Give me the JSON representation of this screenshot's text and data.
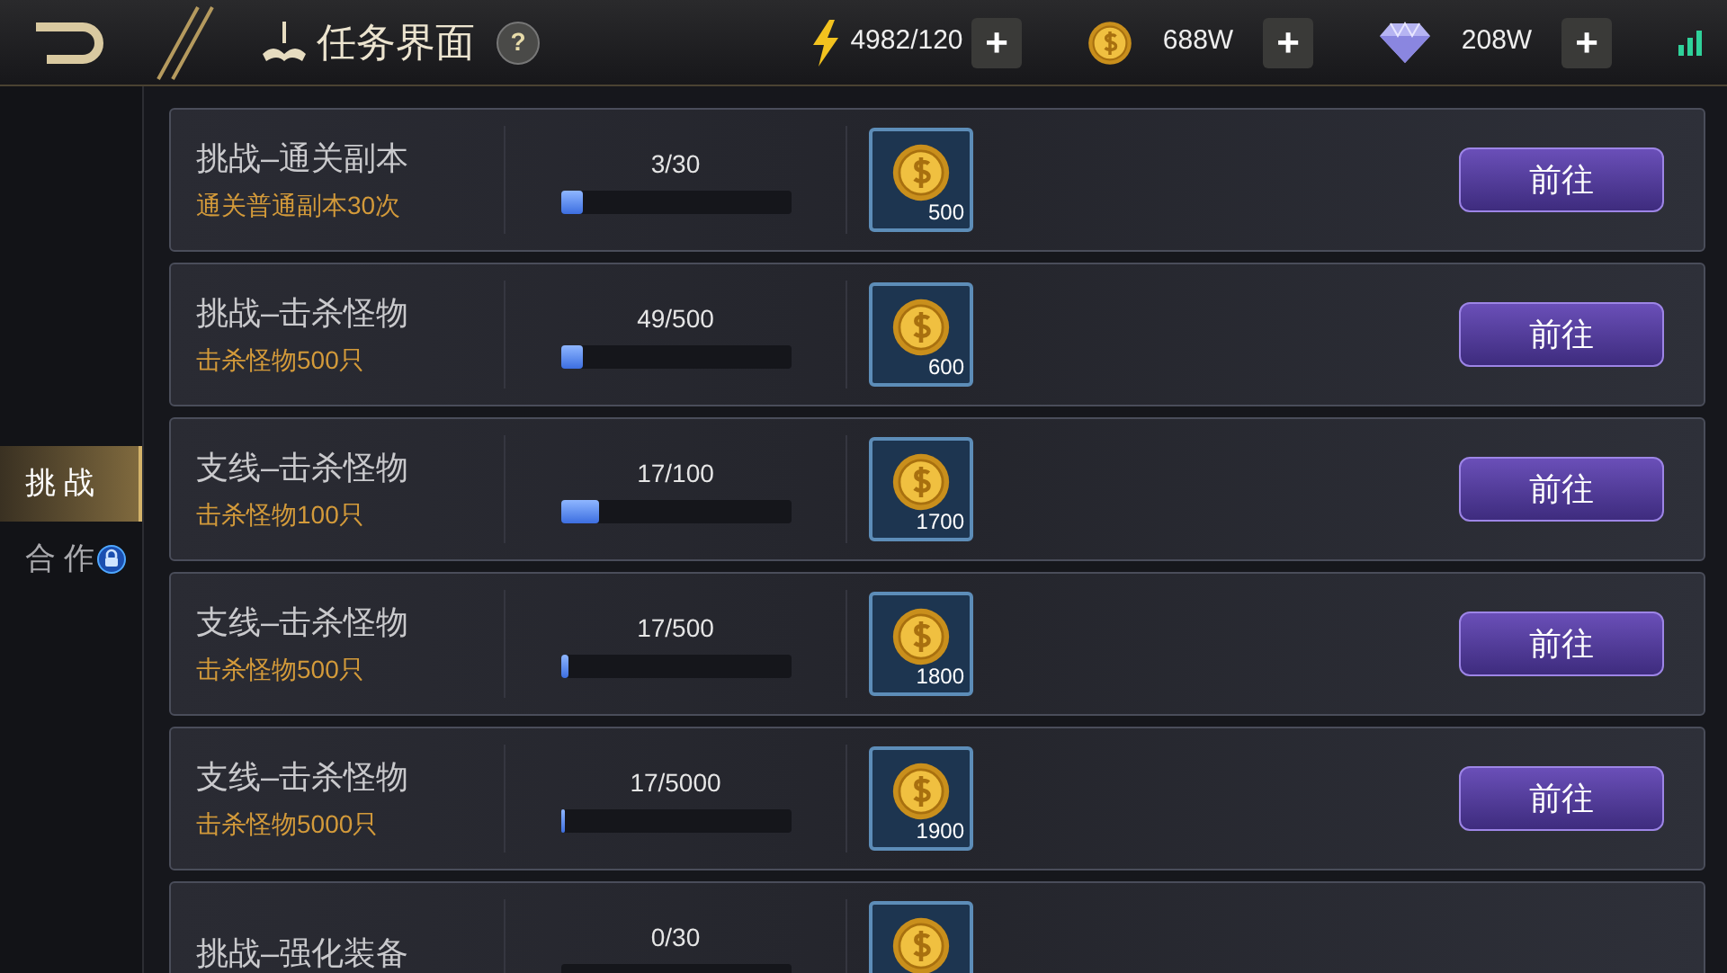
{
  "header": {
    "title": "任务界面",
    "help": "?"
  },
  "resources": [
    {
      "kind": "energy",
      "value": "4982/120",
      "add": "+"
    },
    {
      "kind": "coin",
      "value": "688W",
      "add": "+"
    },
    {
      "kind": "diamond",
      "value": "208W",
      "add": "+"
    }
  ],
  "sidebar": {
    "tabs": [
      {
        "label": "挑 战",
        "selected": true,
        "locked": false
      },
      {
        "label": "合 作",
        "selected": false,
        "locked": true
      }
    ]
  },
  "tasks": [
    {
      "title": "挑战–通关副本",
      "description": "通关普通副本30次",
      "progress": "3/30",
      "level": 0.1,
      "reward": "500",
      "button": "前往"
    },
    {
      "title": "挑战–击杀怪物",
      "description": "击杀怪物500只",
      "progress": "49/500",
      "level": 0.098,
      "reward": "600",
      "button": "前往"
    },
    {
      "title": "支线–击杀怪物",
      "description": "击杀怪物100只",
      "progress": "17/100",
      "level": 0.17,
      "reward": "1700",
      "button": "前往"
    },
    {
      "title": "支线–击杀怪物",
      "description": "击杀怪物500只",
      "progress": "17/500",
      "level": 0.034,
      "reward": "1800",
      "button": "前往"
    },
    {
      "title": "支线–击杀怪物",
      "description": "击杀怪物5000只",
      "progress": "17/5000",
      "level": 0.0034,
      "reward": "1900",
      "button": "前往"
    },
    {
      "title": "挑战–强化装备",
      "progress": "0/30"
    }
  ]
}
